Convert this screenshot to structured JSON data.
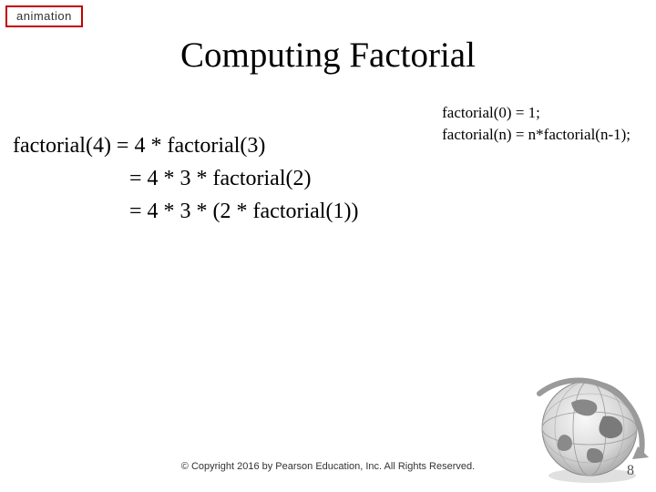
{
  "badge": "animation",
  "title": "Computing Factorial",
  "rules": {
    "line1": "factorial(0) = 1;",
    "line2": "factorial(n) = n*factorial(n-1);"
  },
  "steps": {
    "line1": "factorial(4) = 4 * factorial(3)",
    "line2": "= 4 * 3 * factorial(2)",
    "line3": "= 4 * 3 * (2 * factorial(1))"
  },
  "footer": "© Copyright 2016 by Pearson Education, Inc. All Rights Reserved.",
  "pagenum": "8"
}
